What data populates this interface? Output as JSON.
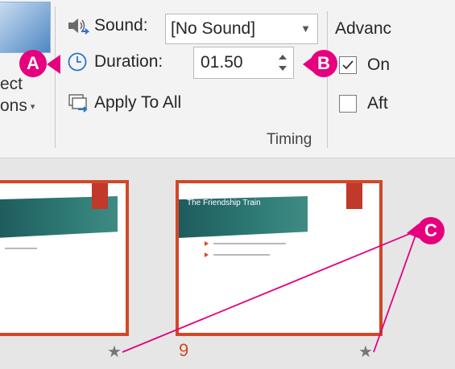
{
  "ribbon": {
    "left_group": {
      "line1": "ect",
      "line2": "ons"
    },
    "sound": {
      "label": "Sound:",
      "value": "[No Sound]"
    },
    "duration": {
      "label": "Duration:",
      "value": "01.50"
    },
    "apply_all": {
      "label": "Apply To All"
    },
    "timing_group_label": "Timing",
    "advance": {
      "title": "Advanc",
      "on_click": "On",
      "after": "Aft",
      "on_click_checked": true,
      "after_checked": false
    }
  },
  "slides": [
    {
      "number": "",
      "title": "",
      "bullets": [
        "",
        ""
      ]
    },
    {
      "number": "9",
      "title": "The Friendship Train",
      "bullets": [
        "",
        ""
      ]
    }
  ],
  "callouts": {
    "a": "A",
    "b": "B",
    "c": "C"
  },
  "colors": {
    "accent": "#d24726",
    "callout": "#e6007e",
    "ribbon_bg": "#f3f3f3",
    "sorter_bg": "#e6e6e6"
  }
}
